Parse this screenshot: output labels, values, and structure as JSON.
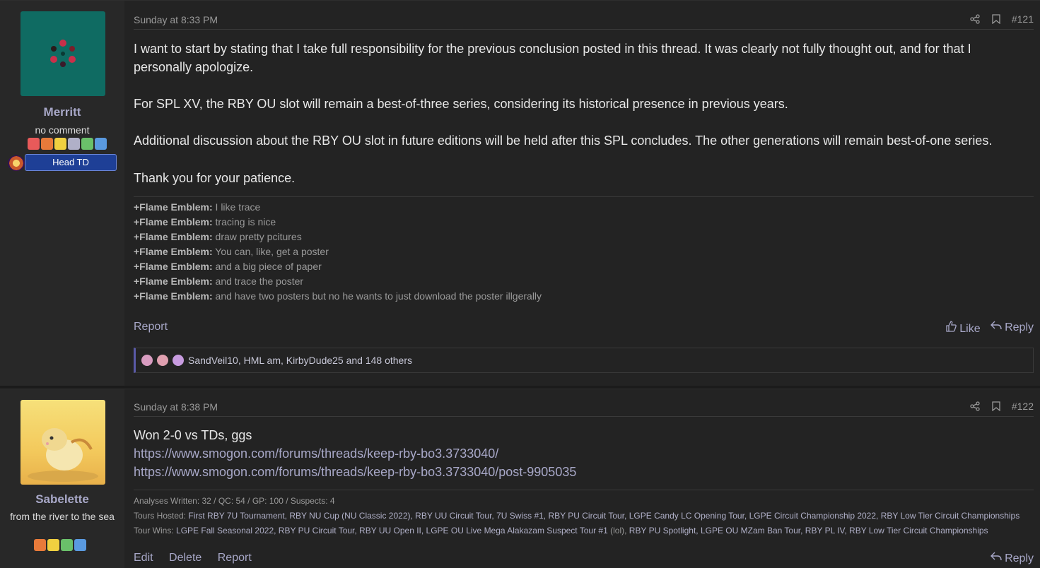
{
  "posts": [
    {
      "username": "Merritt",
      "user_title": "no comment",
      "banner": "Head TD",
      "date": "Sunday at 8:33 PM",
      "number": "#121",
      "paragraphs": [
        "I want to start by stating that I take full responsibility for the previous conclusion posted in this thread. It was clearly not fully thought out, and for that I personally apologize.",
        "For SPL XV, the RBY OU slot will remain a best-of-three series, considering its historical presence in previous years.",
        "Additional discussion about the RBY OU slot in future editions will be held after this SPL concludes. The other generations will remain best-of-one series.",
        "Thank you for your patience."
      ],
      "signature": [
        {
          "name": "+Flame Emblem:",
          "text": " I like trace"
        },
        {
          "name": "+Flame Emblem:",
          "text": " tracing is nice"
        },
        {
          "name": "+Flame Emblem:",
          "text": " draw pretty pcitures"
        },
        {
          "name": "+Flame Emblem:",
          "text": " You can, like, get a poster"
        },
        {
          "name": "+Flame Emblem:",
          "text": " and a big piece of paper"
        },
        {
          "name": "+Flame Emblem:",
          "text": " and trace the poster"
        },
        {
          "name": "+Flame Emblem:",
          "text": " and have two posters but no he wants to just download the poster illgerally"
        }
      ],
      "actions": {
        "report": "Report",
        "like": "Like",
        "reply": "Reply"
      },
      "reactions": "SandVeil10, HML am, KirbyDude25 and 148 others"
    },
    {
      "username": "Sabelette",
      "user_title": "from the river to the sea",
      "date": "Sunday at 8:38 PM",
      "number": "#122",
      "line1": "Won 2-0 vs TDs, ggs",
      "link1": "https://www.smogon.com/forums/threads/keep-rby-bo3.3733040/",
      "link2": "https://www.smogon.com/forums/threads/keep-rby-bo3.3733040/post-9905035",
      "sig_line1": "Analyses Written: 32 / QC: 54 / GP: 100 / Suspects: 4",
      "sig_line2_label": "Tours Hosted:",
      "sig_line2": "First RBY 7U Tournament, RBY NU Cup (NU Classic 2022), RBY UU Circuit Tour, 7U Swiss #1, RBY PU Circuit Tour, LGPE Candy LC Opening Tour, LGPE Circuit Championship 2022, RBY Low Tier Circuit Championships",
      "sig_line3_label": "Tour Wins:",
      "sig_line3a": "LGPE Fall Seasonal 2022, RBY PU Circuit Tour, RBY UU Open II, LGPE OU Live Mega Alakazam Suspect Tour #1",
      "sig_line3b": " (lol), ",
      "sig_line3c": "RBY PU Spotlight, LGPE OU MZam Ban Tour, RBY PL IV, RBY Low Tier Circuit Championships",
      "actions": {
        "edit": "Edit",
        "delete": "Delete",
        "report": "Report",
        "reply": "Reply"
      }
    }
  ],
  "colors": {
    "accent": "#a8a8c8",
    "banner": "#1e3f96"
  },
  "icons": [
    "share-icon",
    "bookmark-icon",
    "like-icon",
    "reply-icon"
  ]
}
